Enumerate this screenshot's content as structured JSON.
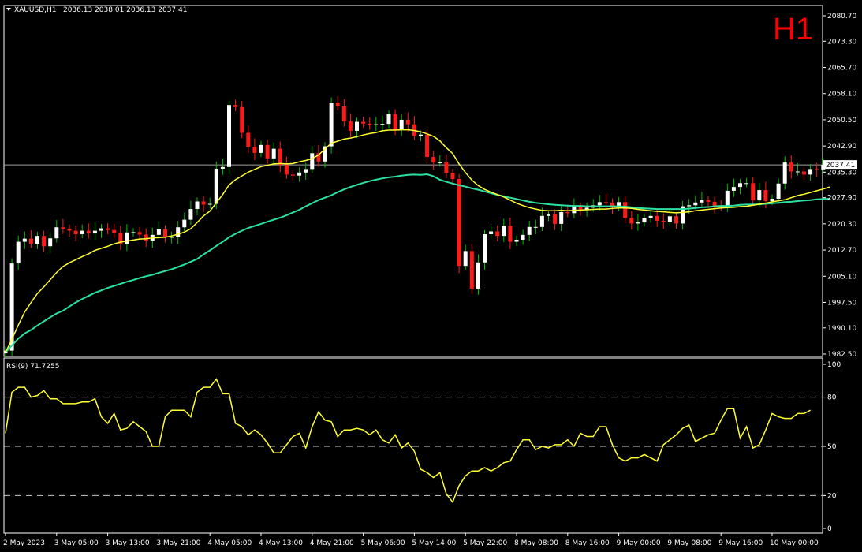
{
  "header": {
    "symbol": "XAUUSD,H1",
    "ohlc": "2036.13 2038.01 2036.13 2037.41",
    "timeframe_badge": "H1",
    "rsi_label": "RSI(9) 71.7255"
  },
  "colors": {
    "background": "#000000",
    "frame": "#ffffff",
    "bull_candle": "#ffffff",
    "bear_candle": "#ff1a1a",
    "bull_wick": "#00c000",
    "ma_fast": "#ffff33",
    "ma_slow": "#2be0a0",
    "rsi_line": "#ffff33",
    "badge": "#ff0000",
    "price_line": "#a0a0a0"
  },
  "chart_data": [
    {
      "type": "candlestick",
      "panel": "price",
      "ylim": [
        1982.5,
        2080.7
      ],
      "yticks": [
        2080.7,
        2073.3,
        2065.7,
        2058.1,
        2050.5,
        2042.9,
        2035.3,
        2027.9,
        2020.3,
        2012.7,
        2005.1,
        1997.5,
        1990.1,
        1982.5
      ],
      "ytick_labels": [
        "2080.70",
        "2073.30",
        "2065.70",
        "2058.10",
        "2050.50",
        "2042.90",
        "2035.30",
        "2027.90",
        "2020.30",
        "2012.70",
        "2005.10",
        "1997.50",
        "1990.10",
        "1982.50"
      ],
      "current_price": 2037.41,
      "current_price_label": "2037.41",
      "xtick_labels": [
        "2 May 2023",
        "3 May 05:00",
        "3 May 13:00",
        "3 May 21:00",
        "4 May 05:00",
        "4 May 13:00",
        "4 May 21:00",
        "5 May 06:00",
        "5 May 14:00",
        "5 May 22:00",
        "8 May 08:00",
        "8 May 16:00",
        "9 May 00:00",
        "9 May 08:00",
        "9 May 16:00",
        "10 May 00:00"
      ],
      "xtick_bar_index": [
        0,
        8,
        16,
        24,
        32,
        40,
        48,
        56,
        64,
        72,
        80,
        88,
        96,
        104,
        112,
        120
      ],
      "close": [
        1983.5,
        2008.8,
        2015.1,
        2016.0,
        2014.5,
        2016.8,
        2013.8,
        2016.1,
        2019.3,
        2018.9,
        2018.3,
        2017.3,
        2018.3,
        2017.5,
        2018.3,
        2019.0,
        2018.5,
        2017.6,
        2014.5,
        2017.8,
        2017.9,
        2017.2,
        2015.4,
        2017.1,
        2018.7,
        2016.4,
        2016.5,
        2019.3,
        2021.5,
        2024.6,
        2026.8,
        2025.9,
        2026.1,
        2036.3,
        2036.8,
        2054.8,
        2054.2,
        2046.7,
        2042.7,
        2040.9,
        2043.2,
        2039.3,
        2042.1,
        2037.4,
        2034.6,
        2034.3,
        2035.2,
        2036.2,
        2040.8,
        2038.4,
        2042.8,
        2055.5,
        2054.4,
        2050.0,
        2047.3,
        2049.9,
        2049.4,
        2049.1,
        2049.2,
        2049.3,
        2052.1,
        2047.6,
        2050.5,
        2049.2,
        2045.8,
        2046.2,
        2039.7,
        2038.1,
        2038.1,
        2035.1,
        2033.3,
        2008.1,
        2012.4,
        2001.5,
        2009.1,
        2017.3,
        2018.1,
        2016.8,
        2019.7,
        2015.1,
        2015.7,
        2017.1,
        2019.4,
        2019.4,
        2022.6,
        2023.0,
        2020.3,
        2023.7,
        2023.4,
        2025.3,
        2024.5,
        2025.0,
        2025.7,
        2026.6,
        2026.5,
        2025.2,
        2026.6,
        2022.0,
        2020.4,
        2020.7,
        2022.1,
        2022.6,
        2021.2,
        2020.9,
        2022.5,
        2020.4,
        2025.4,
        2025.7,
        2026.5,
        2027.2,
        2026.7,
        2025.4,
        2025.2,
        2029.9,
        2031.0,
        2032.1,
        2032.1,
        2027.1,
        2030.1,
        2026.9,
        2027.6,
        2032.0,
        2038.1,
        2035.5,
        2035.5,
        2034.6,
        2036.2,
        2036.1,
        2037.4
      ],
      "ma_fast_values": [
        1983.0,
        1986.8,
        1990.9,
        1994.7,
        1997.5,
        2000.1,
        2002.0,
        2004.1,
        2006.2,
        2007.9,
        2009.0,
        2009.9,
        2010.8,
        2011.6,
        2012.6,
        2013.2,
        2013.8,
        2014.5,
        2015.0,
        2015.3,
        2015.6,
        2015.9,
        2016.0,
        2016.2,
        2016.3,
        2016.4,
        2016.8,
        2017.3,
        2017.9,
        2018.9,
        2020.7,
        2022.6,
        2024.0,
        2026.4,
        2028.8,
        2031.6,
        2033.1,
        2034.2,
        2035.3,
        2036.1,
        2036.9,
        2037.3,
        2037.7,
        2037.8,
        2037.7,
        2037.8,
        2038.3,
        2038.7,
        2039.2,
        2040.3,
        2042.0,
        2043.7,
        2044.3,
        2044.9,
        2045.2,
        2045.6,
        2046.1,
        2046.5,
        2046.8,
        2047.3,
        2047.5,
        2047.5,
        2047.6,
        2047.6,
        2047.4,
        2047.0,
        2046.4,
        2045.7,
        2044.4,
        2042.4,
        2040.7,
        2037.7,
        2035.2,
        2033.0,
        2031.4,
        2030.3,
        2029.5,
        2028.8,
        2028.1,
        2027.2,
        2026.3,
        2025.6,
        2025.0,
        2024.6,
        2024.2,
        2024.1,
        2024.1,
        2024.2,
        2024.1,
        2024.2,
        2024.3,
        2024.4,
        2024.5,
        2024.6,
        2024.6,
        2024.8,
        2024.9,
        2024.9,
        2024.8,
        2024.5,
        2024.3,
        2024.1,
        2023.9,
        2023.8,
        2023.6,
        2023.5,
        2023.6,
        2023.8,
        2024.1,
        2024.3,
        2024.5,
        2024.7,
        2024.9,
        2025.0,
        2025.1,
        2025.3,
        2025.4,
        2025.7,
        2026.0,
        2026.3,
        2026.7,
        2027.0,
        2027.3,
        2027.9,
        2028.5,
        2028.9,
        2029.4,
        2029.9,
        2030.4,
        2031.0
      ],
      "ma_slow_values": [
        1983.0,
        1985.0,
        1987.0,
        1988.5,
        1989.5,
        1990.8,
        1992.0,
        1993.2,
        1994.3,
        1995.1,
        1996.3,
        1997.5,
        1998.5,
        1999.4,
        2000.3,
        2001.0,
        2001.7,
        2002.3,
        2002.9,
        2003.5,
        2004.0,
        2004.6,
        2005.1,
        2005.5,
        2006.1,
        2006.6,
        2007.1,
        2007.8,
        2008.5,
        2009.3,
        2010.1,
        2011.4,
        2012.6,
        2013.9,
        2015.1,
        2016.4,
        2017.4,
        2018.3,
        2019.1,
        2019.7,
        2020.3,
        2020.9,
        2021.5,
        2022.1,
        2022.8,
        2023.6,
        2024.4,
        2025.4,
        2026.3,
        2027.2,
        2027.9,
        2028.6,
        2029.5,
        2030.3,
        2031.0,
        2031.6,
        2032.2,
        2032.7,
        2033.1,
        2033.5,
        2033.8,
        2034.0,
        2034.3,
        2034.5,
        2034.6,
        2034.5,
        2034.7,
        2034.1,
        2033.1,
        2032.5,
        2032.0,
        2031.5,
        2031.1,
        2030.6,
        2030.2,
        2029.7,
        2029.2,
        2028.7,
        2028.3,
        2027.9,
        2027.5,
        2027.1,
        2026.7,
        2026.4,
        2026.2,
        2026.0,
        2025.8,
        2025.7,
        2025.6,
        2025.5,
        2025.5,
        2025.4,
        2025.4,
        2025.4,
        2025.4,
        2025.4,
        2025.4,
        2025.3,
        2025.1,
        2024.9,
        2024.8,
        2024.7,
        2024.6,
        2024.6,
        2024.6,
        2024.6,
        2024.6,
        2024.7,
        2024.9,
        2025.1,
        2025.2,
        2025.4,
        2025.5,
        2025.5,
        2025.6,
        2025.8,
        2025.9,
        2025.9,
        2026.0,
        2026.1,
        2026.3,
        2026.4,
        2026.6,
        2026.7,
        2026.9,
        2027.1,
        2027.2,
        2027.4,
        2027.5,
        2027.6
      ]
    },
    {
      "type": "line",
      "panel": "rsi",
      "name": "RSI(9)",
      "ylim": [
        0,
        100
      ],
      "levels": [
        20,
        50,
        80
      ],
      "yticks": [
        100,
        80,
        50,
        20,
        0
      ],
      "ytick_labels": [
        "100",
        "80",
        "50",
        "20",
        "0"
      ],
      "values": [
        58,
        83,
        86,
        86,
        80,
        81,
        84,
        79,
        79,
        76,
        76,
        76,
        77,
        77,
        79,
        68,
        64,
        70,
        60,
        61,
        65,
        62,
        59,
        50,
        50,
        68,
        72,
        72,
        72,
        68,
        83,
        86,
        86,
        91,
        82,
        82,
        64,
        62,
        57,
        60,
        57,
        52,
        46,
        46,
        51,
        56,
        58,
        49,
        62,
        71,
        66,
        65,
        56,
        60,
        60,
        61,
        60,
        57,
        60,
        54,
        52,
        57,
        49,
        52,
        47,
        36,
        34,
        31,
        34,
        21,
        16,
        26,
        32,
        35,
        35,
        37,
        35,
        37,
        40,
        41,
        48,
        54,
        54,
        48,
        50,
        49,
        51,
        51,
        54,
        50,
        58,
        56,
        56,
        62,
        62,
        51,
        43,
        41,
        43,
        43,
        45,
        43,
        41,
        51,
        54,
        57,
        61,
        63,
        53,
        55,
        57,
        58,
        66,
        73,
        73,
        55,
        62,
        49,
        51,
        60,
        70,
        68,
        67,
        67,
        70,
        70,
        72
      ]
    }
  ]
}
